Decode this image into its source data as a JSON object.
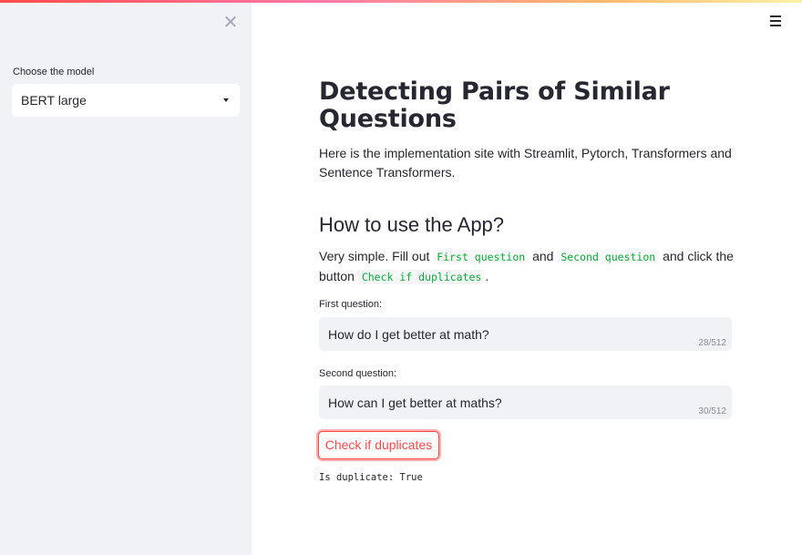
{
  "colors": {
    "accent": "#ff4b4b",
    "sidebar_bg": "#f0f2f6",
    "code_text": "#09ab3b",
    "text": "#262730"
  },
  "sidebar": {
    "close_icon": "close-icon",
    "model_label": "Choose the model",
    "model_selected": "BERT large"
  },
  "header": {
    "menu_icon": "hamburger-menu-icon"
  },
  "main": {
    "title": "Detecting Pairs of Similar Questions",
    "intro": "Here is the implementation site with Streamlit, Pytorch, Transformers and Sentence Transformers.",
    "section_heading": "How to use the App?",
    "instructions": {
      "part1": "Very simple. Fill out ",
      "code1": "First question",
      "part2": " and ",
      "code2": "Second question",
      "part3": " and click the button ",
      "code3": "Check if duplicates",
      "part4": "."
    },
    "first_question": {
      "label": "First question:",
      "value": "How do I get better at math?",
      "count": "28/512"
    },
    "second_question": {
      "label": "Second question:",
      "value": "How can I get better at maths?",
      "count": "30/512"
    },
    "check_button": "Check if duplicates",
    "result": "Is duplicate: True"
  }
}
